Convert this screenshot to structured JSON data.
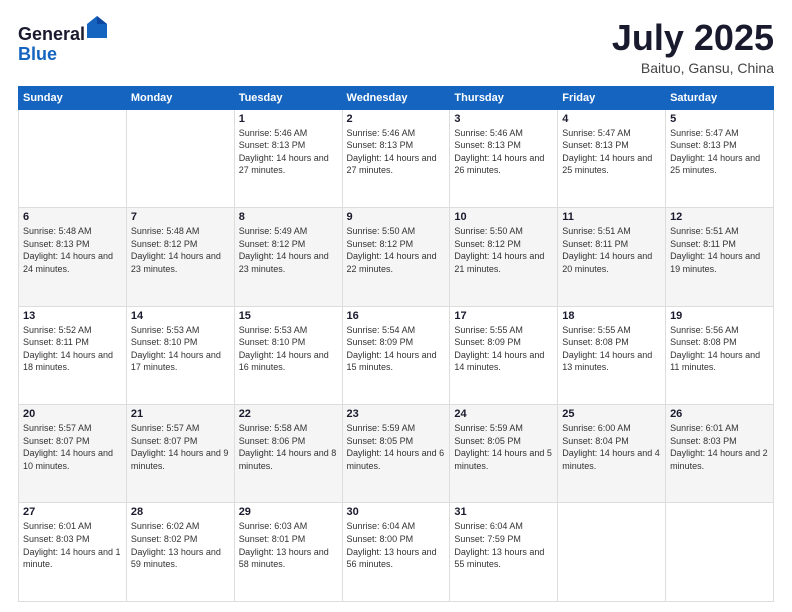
{
  "header": {
    "logo_general": "General",
    "logo_blue": "Blue",
    "month_title": "July 2025",
    "location": "Baituo, Gansu, China"
  },
  "days_of_week": [
    "Sunday",
    "Monday",
    "Tuesday",
    "Wednesday",
    "Thursday",
    "Friday",
    "Saturday"
  ],
  "weeks": [
    [
      {
        "day": "",
        "sunrise": "",
        "sunset": "",
        "daylight": ""
      },
      {
        "day": "",
        "sunrise": "",
        "sunset": "",
        "daylight": ""
      },
      {
        "day": "1",
        "sunrise": "Sunrise: 5:46 AM",
        "sunset": "Sunset: 8:13 PM",
        "daylight": "Daylight: 14 hours and 27 minutes."
      },
      {
        "day": "2",
        "sunrise": "Sunrise: 5:46 AM",
        "sunset": "Sunset: 8:13 PM",
        "daylight": "Daylight: 14 hours and 27 minutes."
      },
      {
        "day": "3",
        "sunrise": "Sunrise: 5:46 AM",
        "sunset": "Sunset: 8:13 PM",
        "daylight": "Daylight: 14 hours and 26 minutes."
      },
      {
        "day": "4",
        "sunrise": "Sunrise: 5:47 AM",
        "sunset": "Sunset: 8:13 PM",
        "daylight": "Daylight: 14 hours and 25 minutes."
      },
      {
        "day": "5",
        "sunrise": "Sunrise: 5:47 AM",
        "sunset": "Sunset: 8:13 PM",
        "daylight": "Daylight: 14 hours and 25 minutes."
      }
    ],
    [
      {
        "day": "6",
        "sunrise": "Sunrise: 5:48 AM",
        "sunset": "Sunset: 8:13 PM",
        "daylight": "Daylight: 14 hours and 24 minutes."
      },
      {
        "day": "7",
        "sunrise": "Sunrise: 5:48 AM",
        "sunset": "Sunset: 8:12 PM",
        "daylight": "Daylight: 14 hours and 23 minutes."
      },
      {
        "day": "8",
        "sunrise": "Sunrise: 5:49 AM",
        "sunset": "Sunset: 8:12 PM",
        "daylight": "Daylight: 14 hours and 23 minutes."
      },
      {
        "day": "9",
        "sunrise": "Sunrise: 5:50 AM",
        "sunset": "Sunset: 8:12 PM",
        "daylight": "Daylight: 14 hours and 22 minutes."
      },
      {
        "day": "10",
        "sunrise": "Sunrise: 5:50 AM",
        "sunset": "Sunset: 8:12 PM",
        "daylight": "Daylight: 14 hours and 21 minutes."
      },
      {
        "day": "11",
        "sunrise": "Sunrise: 5:51 AM",
        "sunset": "Sunset: 8:11 PM",
        "daylight": "Daylight: 14 hours and 20 minutes."
      },
      {
        "day": "12",
        "sunrise": "Sunrise: 5:51 AM",
        "sunset": "Sunset: 8:11 PM",
        "daylight": "Daylight: 14 hours and 19 minutes."
      }
    ],
    [
      {
        "day": "13",
        "sunrise": "Sunrise: 5:52 AM",
        "sunset": "Sunset: 8:11 PM",
        "daylight": "Daylight: 14 hours and 18 minutes."
      },
      {
        "day": "14",
        "sunrise": "Sunrise: 5:53 AM",
        "sunset": "Sunset: 8:10 PM",
        "daylight": "Daylight: 14 hours and 17 minutes."
      },
      {
        "day": "15",
        "sunrise": "Sunrise: 5:53 AM",
        "sunset": "Sunset: 8:10 PM",
        "daylight": "Daylight: 14 hours and 16 minutes."
      },
      {
        "day": "16",
        "sunrise": "Sunrise: 5:54 AM",
        "sunset": "Sunset: 8:09 PM",
        "daylight": "Daylight: 14 hours and 15 minutes."
      },
      {
        "day": "17",
        "sunrise": "Sunrise: 5:55 AM",
        "sunset": "Sunset: 8:09 PM",
        "daylight": "Daylight: 14 hours and 14 minutes."
      },
      {
        "day": "18",
        "sunrise": "Sunrise: 5:55 AM",
        "sunset": "Sunset: 8:08 PM",
        "daylight": "Daylight: 14 hours and 13 minutes."
      },
      {
        "day": "19",
        "sunrise": "Sunrise: 5:56 AM",
        "sunset": "Sunset: 8:08 PM",
        "daylight": "Daylight: 14 hours and 11 minutes."
      }
    ],
    [
      {
        "day": "20",
        "sunrise": "Sunrise: 5:57 AM",
        "sunset": "Sunset: 8:07 PM",
        "daylight": "Daylight: 14 hours and 10 minutes."
      },
      {
        "day": "21",
        "sunrise": "Sunrise: 5:57 AM",
        "sunset": "Sunset: 8:07 PM",
        "daylight": "Daylight: 14 hours and 9 minutes."
      },
      {
        "day": "22",
        "sunrise": "Sunrise: 5:58 AM",
        "sunset": "Sunset: 8:06 PM",
        "daylight": "Daylight: 14 hours and 8 minutes."
      },
      {
        "day": "23",
        "sunrise": "Sunrise: 5:59 AM",
        "sunset": "Sunset: 8:05 PM",
        "daylight": "Daylight: 14 hours and 6 minutes."
      },
      {
        "day": "24",
        "sunrise": "Sunrise: 5:59 AM",
        "sunset": "Sunset: 8:05 PM",
        "daylight": "Daylight: 14 hours and 5 minutes."
      },
      {
        "day": "25",
        "sunrise": "Sunrise: 6:00 AM",
        "sunset": "Sunset: 8:04 PM",
        "daylight": "Daylight: 14 hours and 4 minutes."
      },
      {
        "day": "26",
        "sunrise": "Sunrise: 6:01 AM",
        "sunset": "Sunset: 8:03 PM",
        "daylight": "Daylight: 14 hours and 2 minutes."
      }
    ],
    [
      {
        "day": "27",
        "sunrise": "Sunrise: 6:01 AM",
        "sunset": "Sunset: 8:03 PM",
        "daylight": "Daylight: 14 hours and 1 minute."
      },
      {
        "day": "28",
        "sunrise": "Sunrise: 6:02 AM",
        "sunset": "Sunset: 8:02 PM",
        "daylight": "Daylight: 13 hours and 59 minutes."
      },
      {
        "day": "29",
        "sunrise": "Sunrise: 6:03 AM",
        "sunset": "Sunset: 8:01 PM",
        "daylight": "Daylight: 13 hours and 58 minutes."
      },
      {
        "day": "30",
        "sunrise": "Sunrise: 6:04 AM",
        "sunset": "Sunset: 8:00 PM",
        "daylight": "Daylight: 13 hours and 56 minutes."
      },
      {
        "day": "31",
        "sunrise": "Sunrise: 6:04 AM",
        "sunset": "Sunset: 7:59 PM",
        "daylight": "Daylight: 13 hours and 55 minutes."
      },
      {
        "day": "",
        "sunrise": "",
        "sunset": "",
        "daylight": ""
      },
      {
        "day": "",
        "sunrise": "",
        "sunset": "",
        "daylight": ""
      }
    ]
  ]
}
